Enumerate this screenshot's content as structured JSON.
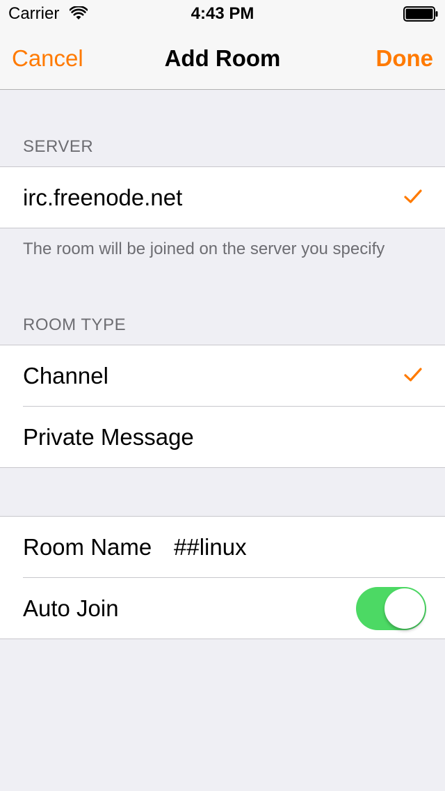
{
  "status_bar": {
    "carrier": "Carrier",
    "time": "4:43 PM",
    "wifi_icon": "wifi-icon",
    "battery_icon": "battery-full-icon"
  },
  "nav": {
    "cancel_label": "Cancel",
    "title": "Add Room",
    "done_label": "Done"
  },
  "server_section": {
    "header": "SERVER",
    "server_name": "irc.freenode.net",
    "selected": true,
    "footer": "The room will be joined on the server you specify"
  },
  "room_type_section": {
    "header": "ROOM TYPE",
    "options": [
      {
        "label": "Channel",
        "selected": true
      },
      {
        "label": "Private Message",
        "selected": false
      }
    ]
  },
  "room_settings": {
    "room_name_label": "Room Name",
    "room_name_value": "##linux",
    "auto_join_label": "Auto Join",
    "auto_join_on": true
  },
  "colors": {
    "accent": "#FF7A00",
    "toggle_on": "#4CD964",
    "background": "#EFEFF4",
    "section_text": "#6D6D72"
  }
}
